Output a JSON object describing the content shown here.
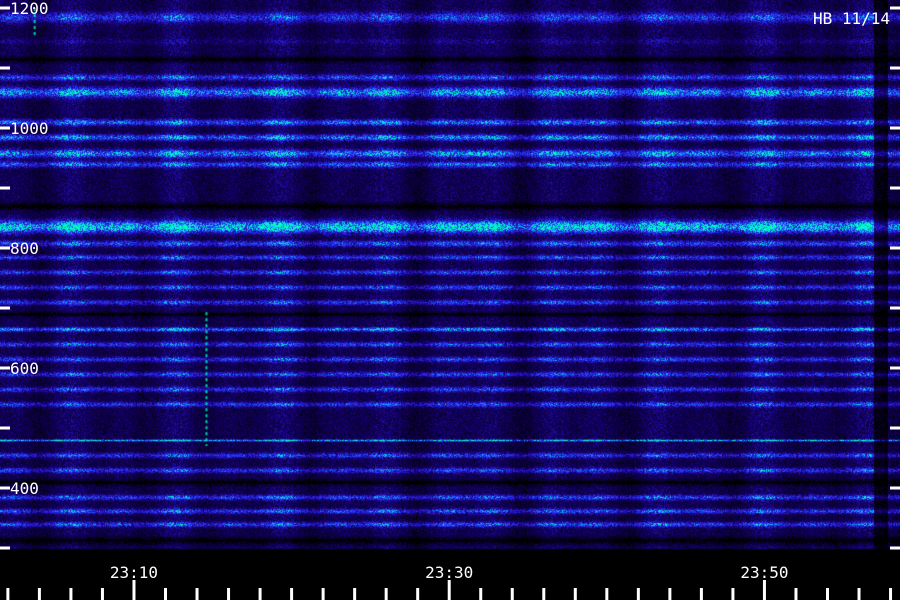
{
  "chart_data": {
    "type": "heatmap",
    "title": "HB 11/14",
    "xlabel": "",
    "ylabel": "",
    "y_ticks": [
      {
        "value": 1200,
        "label": "1200"
      },
      {
        "value": 1000,
        "label": "1000"
      },
      {
        "value": 800,
        "label": "800"
      },
      {
        "value": 600,
        "label": "600"
      },
      {
        "value": 400,
        "label": "400"
      }
    ],
    "y_minor_ticks": [
      1100,
      900,
      700,
      500,
      300
    ],
    "ylim": [
      300,
      1200
    ],
    "x_labels": [
      {
        "value": "23:10",
        "label": "23:10"
      },
      {
        "value": "23:30",
        "label": "23:30"
      },
      {
        "value": "23:50",
        "label": "23:50"
      }
    ],
    "x_ticks_minutes": [
      0,
      2,
      4,
      6,
      8,
      10,
      12,
      14,
      16,
      18,
      20,
      22,
      24,
      26,
      28,
      30,
      32,
      34,
      36,
      38,
      40,
      42,
      44,
      46,
      48,
      50,
      52,
      54,
      56,
      58
    ],
    "x_major_minutes": [
      10,
      30,
      50
    ],
    "xlim_minutes": [
      1.5,
      58.6
    ],
    "colormap": [
      "#000000",
      "#14006a",
      "#2a1ad8",
      "#1e4aff",
      "#10c8e8",
      "#00ffc0"
    ],
    "bands": [
      {
        "freq": 1185,
        "width": 10,
        "intensity": 0.45
      },
      {
        "freq": 1145,
        "width": 6,
        "intensity": 0.1
      },
      {
        "freq": 1085,
        "width": 6,
        "intensity": 0.5
      },
      {
        "freq": 1060,
        "width": 10,
        "intensity": 0.75
      },
      {
        "freq": 1010,
        "width": 6,
        "intensity": 0.6
      },
      {
        "freq": 985,
        "width": 6,
        "intensity": 0.65
      },
      {
        "freq": 958,
        "width": 8,
        "intensity": 0.7
      },
      {
        "freq": 940,
        "width": 6,
        "intensity": 0.55
      },
      {
        "freq": 836,
        "width": 12,
        "intensity": 1.0
      },
      {
        "freq": 808,
        "width": 6,
        "intensity": 0.5
      },
      {
        "freq": 785,
        "width": 5,
        "intensity": 0.45
      },
      {
        "freq": 760,
        "width": 5,
        "intensity": 0.45
      },
      {
        "freq": 735,
        "width": 5,
        "intensity": 0.45
      },
      {
        "freq": 710,
        "width": 5,
        "intensity": 0.45
      },
      {
        "freq": 665,
        "width": 4,
        "intensity": 0.7
      },
      {
        "freq": 640,
        "width": 5,
        "intensity": 0.45
      },
      {
        "freq": 615,
        "width": 5,
        "intensity": 0.45
      },
      {
        "freq": 590,
        "width": 5,
        "intensity": 0.45
      },
      {
        "freq": 565,
        "width": 5,
        "intensity": 0.45
      },
      {
        "freq": 540,
        "width": 5,
        "intensity": 0.45
      },
      {
        "freq": 480,
        "width": 2,
        "intensity": 0.95
      },
      {
        "freq": 455,
        "width": 5,
        "intensity": 0.45
      },
      {
        "freq": 430,
        "width": 5,
        "intensity": 0.45
      },
      {
        "freq": 385,
        "width": 5,
        "intensity": 0.5
      },
      {
        "freq": 362,
        "width": 5,
        "intensity": 0.5
      },
      {
        "freq": 340,
        "width": 5,
        "intensity": 0.5
      }
    ],
    "dark_gaps": [
      {
        "freq": 1115,
        "width": 8
      },
      {
        "freq": 870,
        "width": 10
      },
      {
        "freq": 690,
        "width": 6
      },
      {
        "freq": 410,
        "width": 8
      },
      {
        "freq": 313,
        "width": 10
      }
    ],
    "vertical_events": [
      {
        "time_minute": 3.7,
        "freq_from": 1200,
        "freq_to": 1150
      },
      {
        "time_minute": 14.6,
        "freq_from": 693,
        "freq_to": 470
      }
    ]
  }
}
